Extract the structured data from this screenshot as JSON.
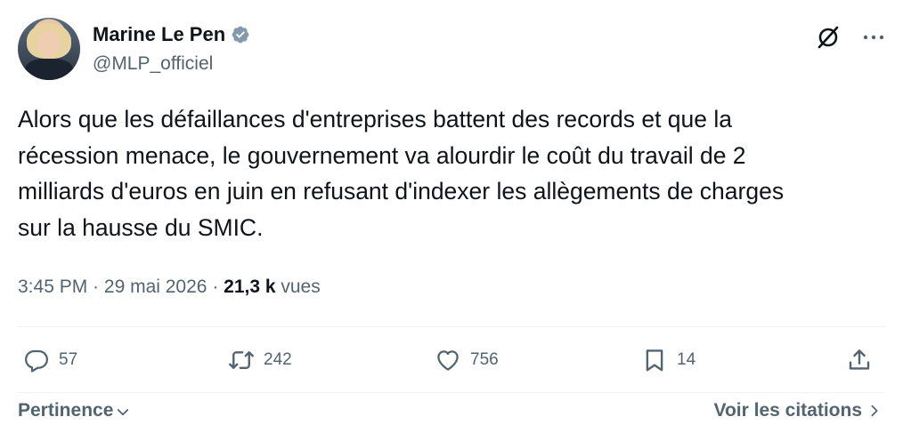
{
  "author": {
    "display_name": "Marine Le Pen",
    "handle": "@MLP_officiel",
    "verified": true,
    "verified_color": "#829aab"
  },
  "tweet": {
    "text": "Alors que les défaillances d'entreprises battent des records et que la\nrécession menace, le gouvernement va alourdir le coût du travail de 2\nmilliards d'euros en juin en refusant d'indexer les allègements de charges\nsur la hausse du SMIC."
  },
  "meta": {
    "time": "3:45 PM",
    "separator": " · ",
    "date": "29 mai 2026",
    "views_count": "21,3 k",
    "views_label": " vues"
  },
  "actions": {
    "replies": "57",
    "reposts": "242",
    "likes": "756",
    "bookmarks": "14"
  },
  "footer": {
    "sort_label": "Pertinence",
    "quotes_label": "Voir les citations"
  },
  "icons": [
    "grok-icon",
    "more-icon",
    "reply-icon",
    "repost-icon",
    "like-icon",
    "bookmark-icon",
    "share-icon",
    "chevron-down-icon",
    "chevron-right-icon",
    "verified-badge-icon"
  ]
}
